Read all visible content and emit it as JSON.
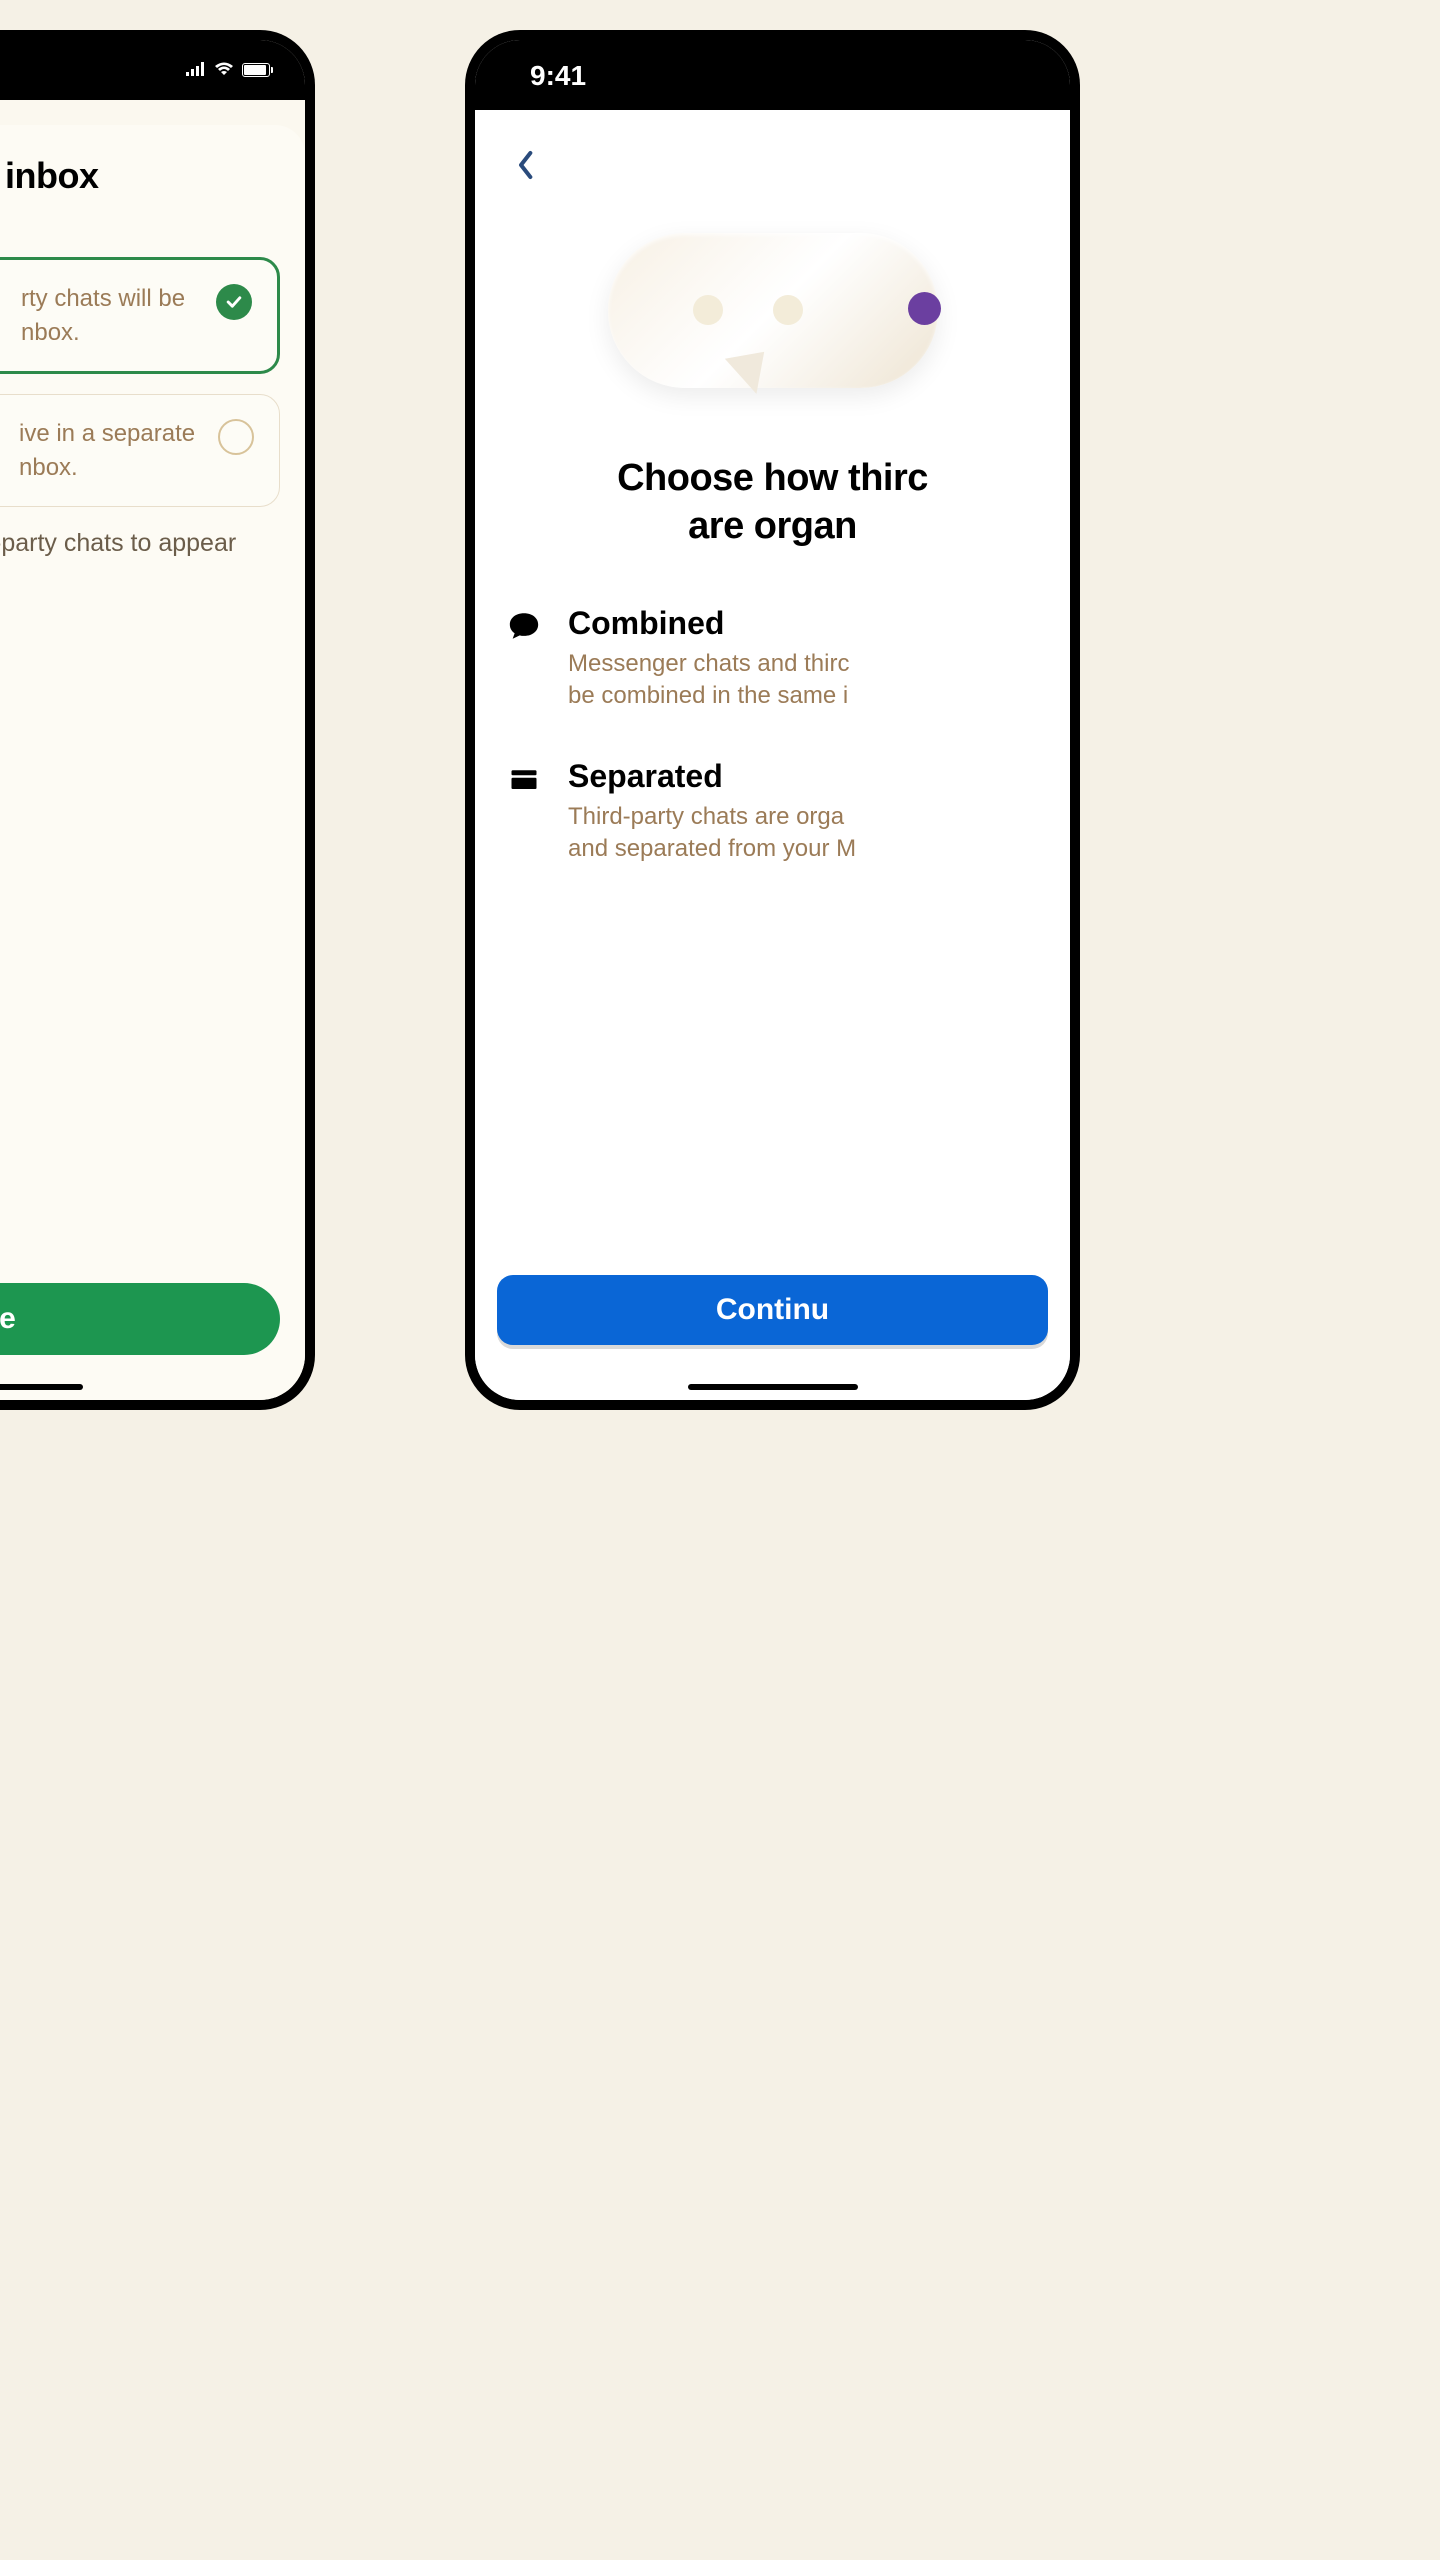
{
  "left_phone": {
    "status": {
      "signal": "signal",
      "wifi": "wifi",
      "battery": "battery-full"
    },
    "title": "inbox",
    "options": [
      {
        "text_fragment": "rty chats will be\nnbox.",
        "selected": true
      },
      {
        "text_fragment": "ive in a separate\nnbox.",
        "selected": false
      }
    ],
    "helper_fragment": "-party chats to appear",
    "primary_button_fragment": "e"
  },
  "right_phone": {
    "status": {
      "time": "9:41"
    },
    "back_icon": "chevron-left",
    "title_fragment": "Choose how thirc\nare organ",
    "choices": [
      {
        "icon": "chat-bubble",
        "title": "Combined",
        "desc_fragment": "Messenger chats and thirc\nbe combined in the same i"
      },
      {
        "icon": "folder",
        "title": "Separated",
        "desc_fragment": "Third-party chats are orga\nand separated from your M"
      }
    ],
    "primary_button_fragment": "Continu"
  },
  "colors": {
    "green": "#1d9650",
    "blue": "#0a66d6",
    "muted_text": "#9b7b57"
  }
}
